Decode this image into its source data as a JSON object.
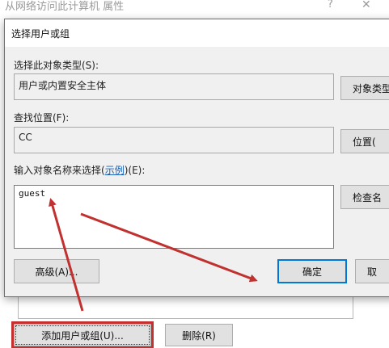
{
  "background_window": {
    "title": "从网络访问此计算机 属性",
    "help_glyph": "?",
    "close_glyph": "✕",
    "add_button": "添加用户或组(U)...",
    "remove_button": "删除(R)"
  },
  "dialog": {
    "title": "选择用户或组",
    "object_type_label": "选择此对象类型(S):",
    "object_type_value": "用户或内置安全主体",
    "object_types_button": "对象类型",
    "location_label": "查找位置(F):",
    "location_value": "CC",
    "locations_button": "位置(",
    "enter_names_label_prefix": "输入对象名称来选择(",
    "enter_names_label_link": "示例",
    "enter_names_label_suffix": ")(E):",
    "enter_names_value": "guest",
    "check_names_button": "检查名",
    "advanced_button": "高级(A)...",
    "ok_button": "确定",
    "cancel_button": "取"
  },
  "annotation": {
    "arrow_color": "#c0312f"
  }
}
